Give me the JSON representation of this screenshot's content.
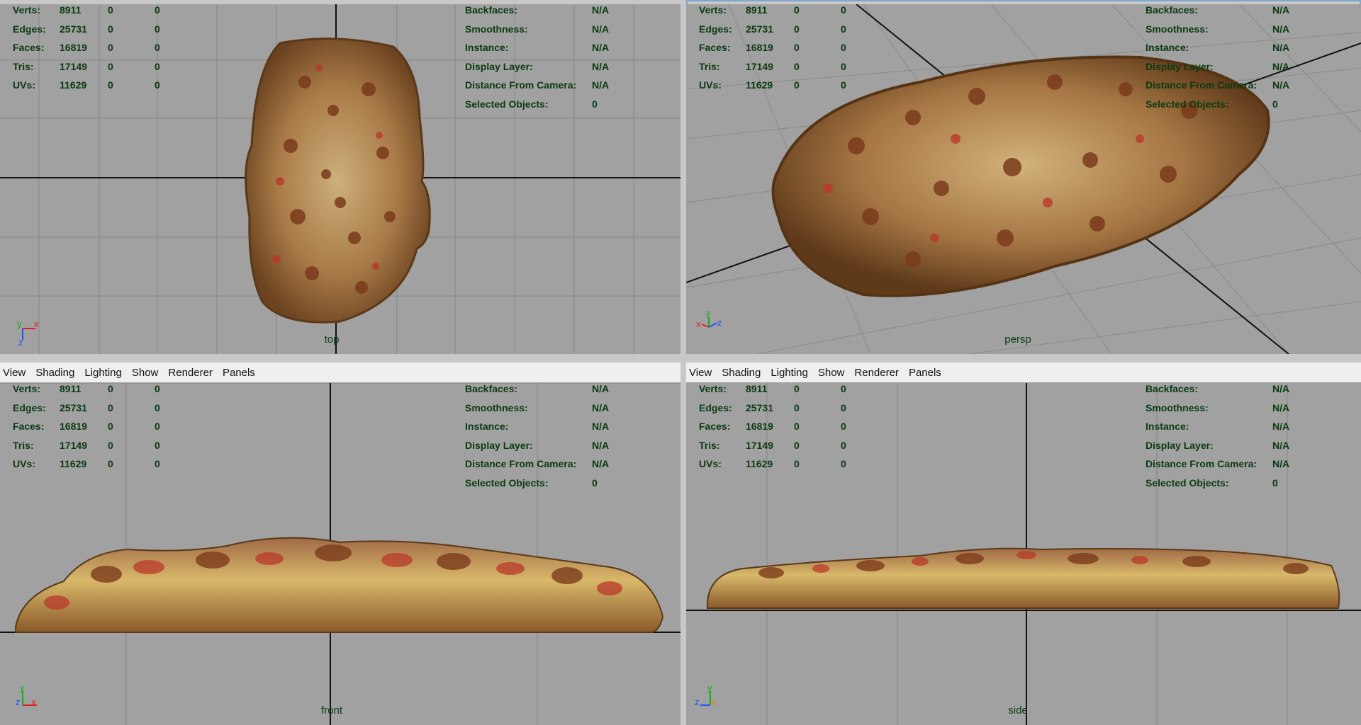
{
  "menu": [
    "View",
    "Shading",
    "Lighting",
    "Show",
    "Renderer",
    "Panels"
  ],
  "stats": [
    {
      "label": "Verts:",
      "v": "8911",
      "a": "0",
      "b": "0"
    },
    {
      "label": "Edges:",
      "v": "25731",
      "a": "0",
      "b": "0"
    },
    {
      "label": "Faces:",
      "v": "16819",
      "a": "0",
      "b": "0"
    },
    {
      "label": "Tris:",
      "v": "17149",
      "a": "0",
      "b": "0"
    },
    {
      "label": "UVs:",
      "v": "11629",
      "a": "0",
      "b": "0"
    }
  ],
  "props": [
    {
      "label": "Backfaces:",
      "v": "N/A"
    },
    {
      "label": "Smoothness:",
      "v": "N/A"
    },
    {
      "label": "Instance:",
      "v": "N/A"
    },
    {
      "label": "Display Layer:",
      "v": "N/A"
    },
    {
      "label": "Distance From Camera:",
      "v": "N/A"
    },
    {
      "label": "Selected Objects:",
      "v": "0"
    }
  ],
  "viewports": {
    "top": {
      "camera": "top",
      "axes": [
        "y",
        "x",
        "z"
      ]
    },
    "persp": {
      "camera": "persp",
      "axes": [
        "x",
        "y",
        "z"
      ]
    },
    "front": {
      "camera": "front",
      "axes": [
        "y",
        "z",
        "x"
      ]
    },
    "side": {
      "camera": "side",
      "axes": [
        "y",
        "z",
        "x"
      ]
    }
  },
  "colors": {
    "viewport_bg": "#a1a1a1",
    "grid": "#878787",
    "axis": "#111111",
    "hud_text": "#0a3a10"
  }
}
